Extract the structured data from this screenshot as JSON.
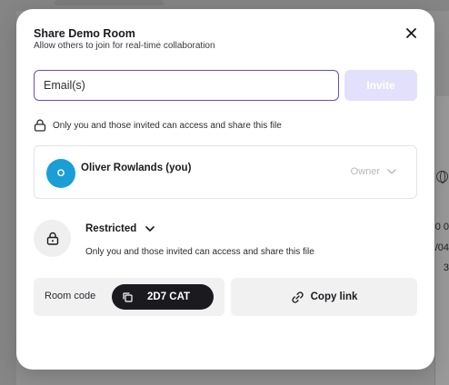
{
  "background": {
    "fragments": [
      "0 0",
      "1/04",
      "3"
    ]
  },
  "modal": {
    "title": "Share Demo Room",
    "subtitle": "Allow others to join for real-time collaboration",
    "close_icon": "close-icon"
  },
  "invite": {
    "email_value": "",
    "email_placeholder": "Email(s)",
    "invite_label": "Invite",
    "accent_color": "#6d48c9",
    "invite_disabled_color": "#e3e0fb"
  },
  "access_notice": {
    "icon": "lock-icon",
    "text": "Only you and those invited can access and share this file"
  },
  "members": [
    {
      "avatar_initial": "O",
      "name": "Oliver Rowlands (you)",
      "role": "Owner",
      "avatar_color": "#1a9ed6"
    }
  ],
  "general_access": {
    "icon": "lock-icon",
    "level": "Restricted",
    "description": "Only you and those invited can access and share this file"
  },
  "room_code": {
    "label": "Room code",
    "value": "2D7 CAT",
    "icon": "copy-icon"
  },
  "copy_link": {
    "label": "Copy link",
    "icon": "link-icon"
  }
}
